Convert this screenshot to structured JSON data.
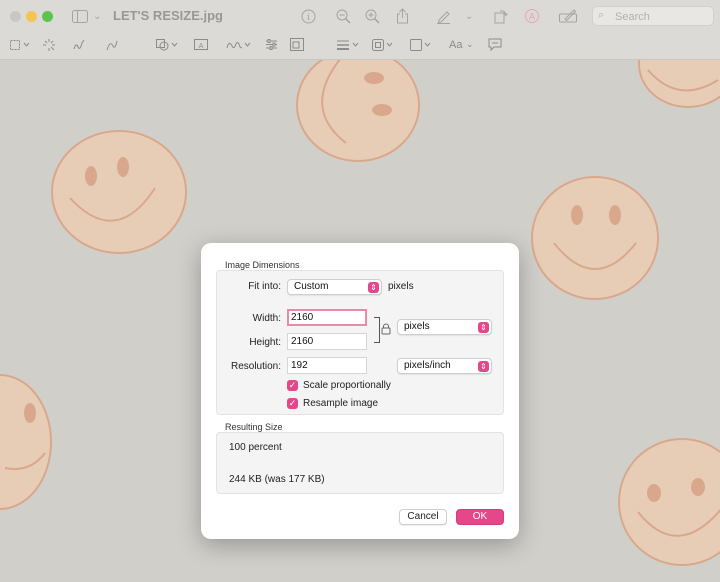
{
  "window": {
    "title": "LET'S RESIZE.jpg",
    "search_placeholder": "Search"
  },
  "colors": {
    "accent": "#e4488a",
    "smiley_fill": "#e8cdb6",
    "smiley_stroke": "#d9a88c",
    "background": "#d1cfca"
  },
  "dialog": {
    "image_dimensions_label": "Image Dimensions",
    "fit_into_label": "Fit into:",
    "fit_into_value": "Custom",
    "fit_into_unit": "pixels",
    "width_label": "Width:",
    "width_value": "2160",
    "height_label": "Height:",
    "height_value": "2160",
    "size_unit_value": "pixels",
    "resolution_label": "Resolution:",
    "resolution_value": "192",
    "resolution_unit_value": "pixels/inch",
    "scale_proportionally_label": "Scale proportionally",
    "scale_proportionally_checked": true,
    "resample_label": "Resample image",
    "resample_checked": true,
    "resulting_size_label": "Resulting Size",
    "percent_text": "100 percent",
    "size_text": "244 KB (was 177 KB)",
    "cancel_label": "Cancel",
    "ok_label": "OK"
  }
}
